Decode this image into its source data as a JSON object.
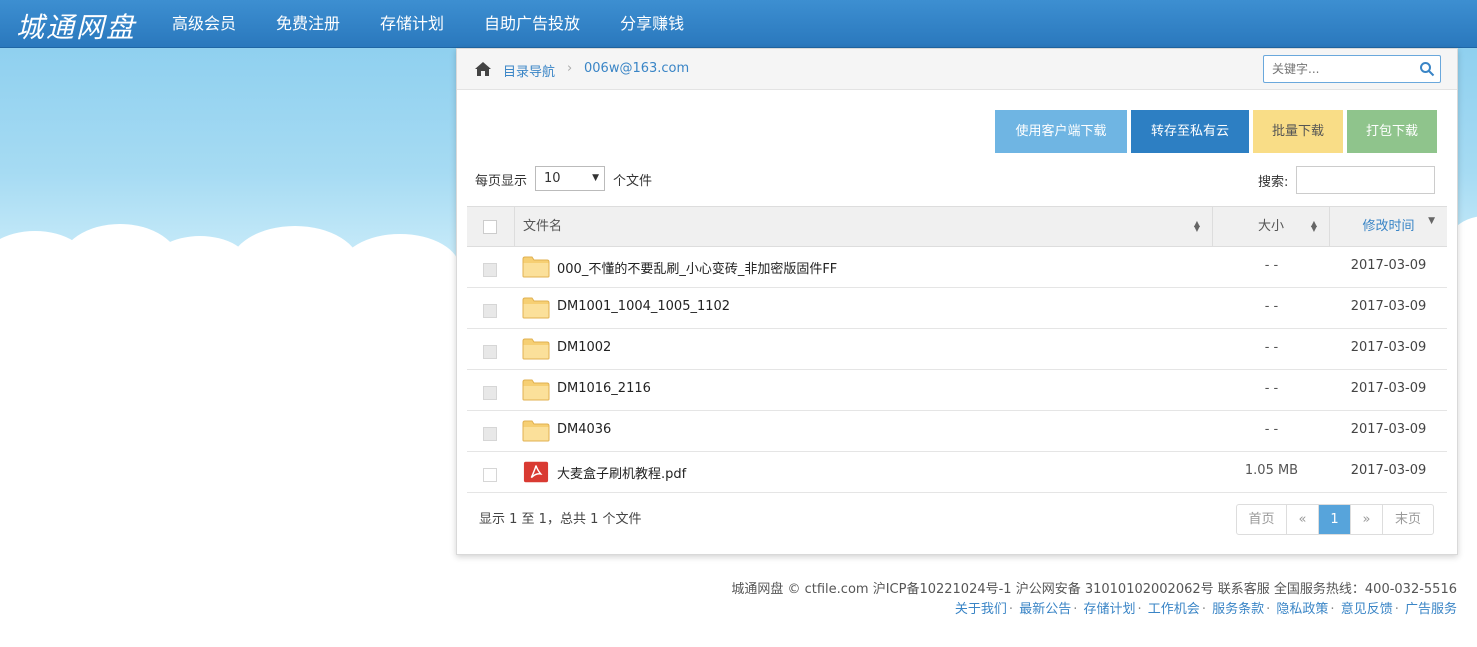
{
  "header": {
    "logo": "城通网盘",
    "nav": [
      "高级会员",
      "免费注册",
      "存储计划",
      "自助广告投放",
      "分享赚钱"
    ]
  },
  "breadcrumb": {
    "root": "目录导航",
    "separator": "›",
    "current": "006w@163.com"
  },
  "search_top": {
    "placeholder": "关键字..."
  },
  "actions": {
    "client_download": "使用客户端下载",
    "save_private": "转存至私有云",
    "batch_download": "批量下载",
    "pack_download": "打包下载"
  },
  "list_controls": {
    "per_page_label": "每页显示",
    "per_page_value": "10",
    "per_page_suffix": "个文件",
    "search_label": "搜索:"
  },
  "table": {
    "headers": {
      "name": "文件名",
      "size": "大小",
      "time": "修改时间"
    },
    "rows": [
      {
        "name": "000_不懂的不要乱刷_小心变砖_非加密版固件FF",
        "size": "- -",
        "date": "2017-03-09",
        "type": "folder"
      },
      {
        "name": "DM1001_1004_1005_1102",
        "size": "- -",
        "date": "2017-03-09",
        "type": "folder"
      },
      {
        "name": "DM1002",
        "size": "- -",
        "date": "2017-03-09",
        "type": "folder"
      },
      {
        "name": "DM1016_2116",
        "size": "- -",
        "date": "2017-03-09",
        "type": "folder"
      },
      {
        "name": "DM4036",
        "size": "- -",
        "date": "2017-03-09",
        "type": "folder"
      },
      {
        "name": "大麦盒子刷机教程.pdf",
        "size": "1.05 MB",
        "date": "2017-03-09",
        "type": "pdf"
      }
    ]
  },
  "summary": "显示 1 至 1，总共 1 个文件",
  "pagination": {
    "first": "首页",
    "prev": "«",
    "current": "1",
    "next": "»",
    "last": "末页"
  },
  "footer": {
    "line1": "城通网盘 © ctfile.com  沪ICP备10221024号-1   沪公网安备 31010102002062号  联系客服  全国服务热线：400-032-5516",
    "links": [
      "关于我们",
      "最新公告",
      "存储计划",
      "工作机会",
      "服务条款",
      "隐私政策",
      "意见反馈",
      "广告服务"
    ]
  },
  "colors": {
    "topbar": "#2a78bd",
    "link": "#3a85c6",
    "btn_client": "#6fb5e3",
    "btn_save": "#2d7fc3",
    "btn_batch": "#f9dd87",
    "btn_pack": "#8fc48c",
    "pager_active": "#57a4db"
  }
}
